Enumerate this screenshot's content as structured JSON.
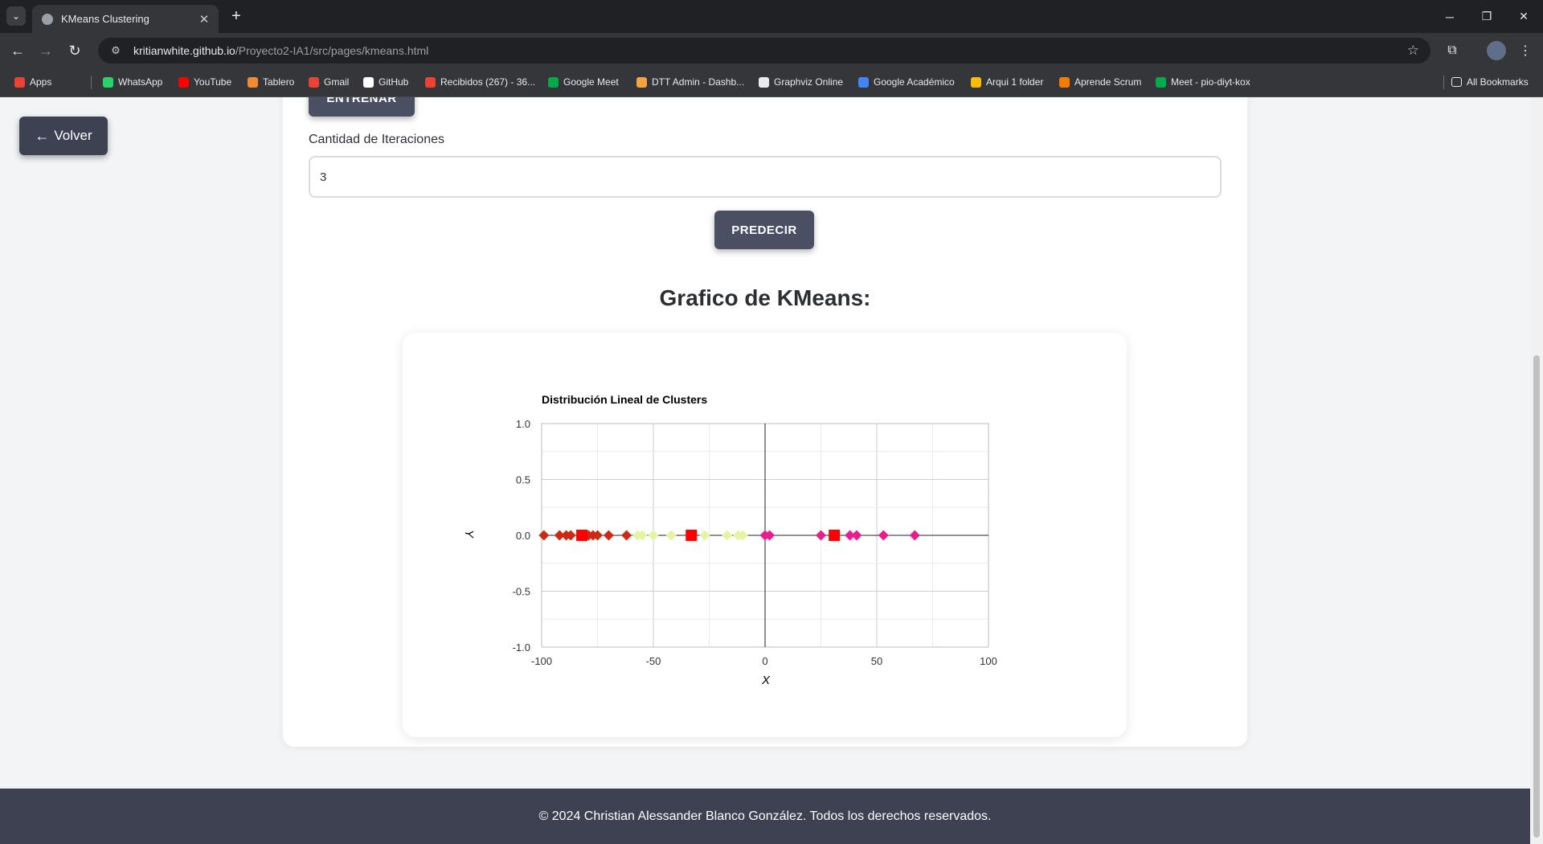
{
  "browser": {
    "tab_title": "KMeans Clustering",
    "url_host": "kritianwhite.github.io",
    "url_path": "/Proyecto2-IA1/src/pages/kmeans.html",
    "bookmarks": [
      {
        "label": "Apps",
        "icon": "apps-grid-icon",
        "color": "#ea4335"
      },
      {
        "label": "WhatsApp",
        "icon": "whatsapp-icon",
        "color": "#25d366"
      },
      {
        "label": "YouTube",
        "icon": "youtube-icon",
        "color": "#ff0000"
      },
      {
        "label": "Tablero",
        "icon": "tablero-icon",
        "color": "#f28b30"
      },
      {
        "label": "Gmail",
        "icon": "gmail-icon",
        "color": "#ea4335"
      },
      {
        "label": "GitHub",
        "icon": "github-icon",
        "color": "#ffffff"
      },
      {
        "label": "Recibidos (267) - 36...",
        "icon": "gmail-icon",
        "color": "#ea4335"
      },
      {
        "label": "Google Meet",
        "icon": "google-meet-icon",
        "color": "#00ac47"
      },
      {
        "label": "DTT Admin - Dashb...",
        "icon": "dtt-admin-icon",
        "color": "#f4a340"
      },
      {
        "label": "Graphviz Online",
        "icon": "graphviz-icon",
        "color": "#e8eaed"
      },
      {
        "label": "Google Académico",
        "icon": "google-scholar-icon",
        "color": "#4285f4"
      },
      {
        "label": "Arqui 1 folder",
        "icon": "google-drive-icon",
        "color": "#fbbc04"
      },
      {
        "label": "Aprende Scrum",
        "icon": "aprende-scrum-icon",
        "color": "#f57c00"
      },
      {
        "label": "Meet - pio-diyt-kox",
        "icon": "google-meet-icon",
        "color": "#00ac47"
      }
    ],
    "all_bookmarks_label": "All Bookmarks"
  },
  "page": {
    "back_label": "Volver",
    "train_label": "ENTRENAR",
    "iterations_label": "Cantidad de Iteraciones",
    "iterations_value": "3",
    "predict_label": "PREDECIR",
    "graph_heading": "Grafico de KMeans:",
    "footer": "© 2024 Christian Alessander Blanco González. Todos los derechos reservados."
  },
  "chart_data": {
    "type": "scatter",
    "title": "Distribución Lineal de Clusters",
    "xlabel": "X",
    "ylabel": "Y",
    "xlim": [
      -100,
      100
    ],
    "ylim": [
      -1,
      1
    ],
    "x_ticks": [
      "-100",
      "-50",
      "0",
      "50",
      "100"
    ],
    "y_ticks": [
      "1.0",
      "0.5",
      "0.0",
      "-0.5",
      "-1.0"
    ],
    "grid": true,
    "legend": "none",
    "series": [
      {
        "color": "#cc2a14",
        "marker": "diamond",
        "points": [
          [
            -99,
            0
          ],
          [
            -92,
            0
          ],
          [
            -89,
            0
          ],
          [
            -87,
            0
          ],
          [
            -79,
            0
          ],
          [
            -77,
            0
          ],
          [
            -75,
            0
          ],
          [
            -70,
            0
          ],
          [
            -62,
            0
          ]
        ]
      },
      {
        "color": "#e4f5a2",
        "marker": "diamond",
        "points": [
          [
            -57,
            0
          ],
          [
            -55,
            0
          ],
          [
            -50,
            0
          ],
          [
            -42,
            0
          ],
          [
            -27,
            0
          ],
          [
            -17,
            0
          ],
          [
            -12,
            0
          ],
          [
            -10,
            0
          ]
        ]
      },
      {
        "color": "#e91e8c",
        "marker": "diamond",
        "points": [
          [
            0,
            0
          ],
          [
            2,
            0
          ],
          [
            25,
            0
          ],
          [
            38,
            0
          ],
          [
            41,
            0
          ],
          [
            53,
            0
          ],
          [
            67,
            0
          ]
        ]
      },
      {
        "color": "#ff0000",
        "marker": "square",
        "points": [
          [
            -82,
            0
          ],
          [
            -33,
            0
          ],
          [
            31,
            0
          ]
        ]
      }
    ]
  }
}
